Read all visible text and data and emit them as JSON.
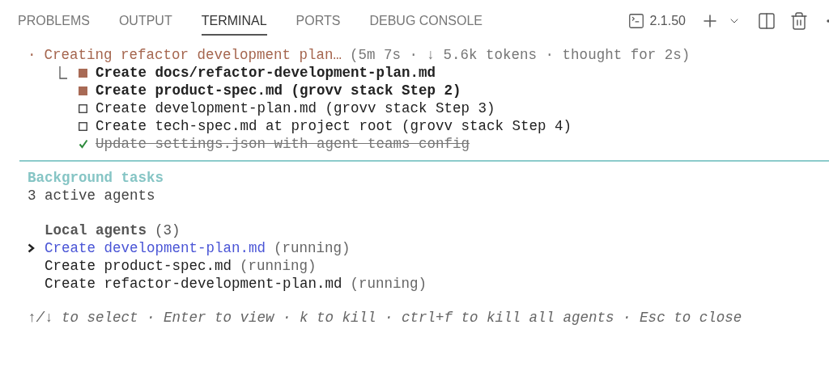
{
  "tabs": [
    {
      "label": "PROBLEMS",
      "selected": false
    },
    {
      "label": "OUTPUT",
      "selected": false
    },
    {
      "label": "TERMINAL",
      "selected": true
    },
    {
      "label": "PORTS",
      "selected": false
    },
    {
      "label": "DEBUG CONSOLE",
      "selected": false
    }
  ],
  "toolbar": {
    "version": "2.1.50"
  },
  "spinner": {
    "mark": "·",
    "text": "Creating refactor development plan…",
    "meta": "(5m 7s · ↓ 5.6k tokens · thought for 2s)"
  },
  "tasks": [
    {
      "text": "Create docs/refactor-development-plan.md",
      "kind": "active"
    },
    {
      "text": "Create product-spec.md (grovv stack Step 2)",
      "kind": "active"
    },
    {
      "text": "Create development-plan.md (grovv stack Step 3)",
      "kind": "pending"
    },
    {
      "text": "Create tech-spec.md at project root (grovv stack Step 4)",
      "kind": "pending"
    },
    {
      "text": "Update settings.json with agent teams config",
      "kind": "done"
    }
  ],
  "background": {
    "title": "Background tasks",
    "subtitle": "3 active agents",
    "group": {
      "label": "Local agents",
      "count": "(3)"
    },
    "agents": [
      {
        "name": "Create development-plan.md",
        "state": "(running)",
        "selected": true
      },
      {
        "name": "Create product-spec.md",
        "state": "(running)",
        "selected": false
      },
      {
        "name": "Create refactor-development-plan.md",
        "state": "(running)",
        "selected": false
      }
    ],
    "hint": "↑/↓ to select · Enter to view · k to kill · ctrl+f to kill all agents · Esc to close"
  }
}
